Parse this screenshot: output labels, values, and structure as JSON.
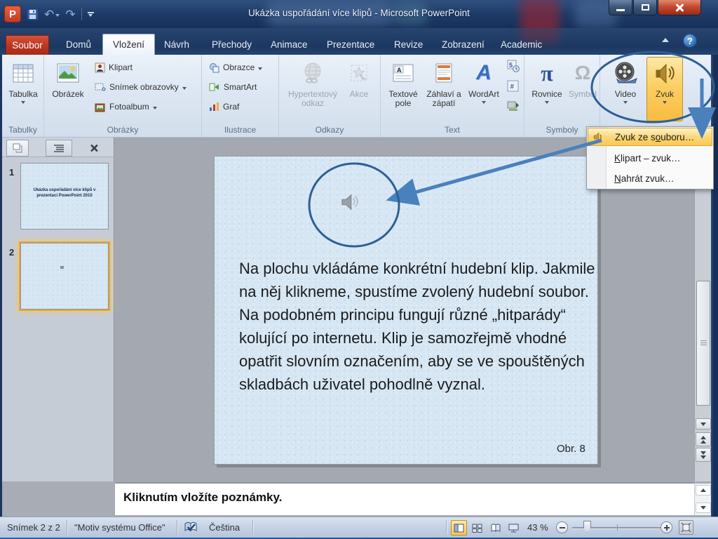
{
  "window": {
    "title": "Ukázka uspořádání více klipů  -  Microsoft PowerPoint"
  },
  "tabs": {
    "file": "Soubor",
    "items": [
      "Domů",
      "Vložení",
      "Návrh",
      "Přechody",
      "Animace",
      "Prezentace",
      "Revize",
      "Zobrazení",
      "Academic"
    ],
    "active": "Vložení"
  },
  "ribbon": {
    "tabulka": "Tabulka",
    "obrazek": "Obrázek",
    "klipart": "Klipart",
    "snimek": "Snímek obrazovky",
    "fotoalbum": "Fotoalbum",
    "obrazce": "Obrazce",
    "smartart": "SmartArt",
    "graf": "Graf",
    "hypertext": "Hypertextový odkaz",
    "akce": "Akce",
    "textove_pole": "Textové pole",
    "zahlavi": "Záhlaví a zápatí",
    "wordart": "WordArt",
    "rovnice": "Rovnice",
    "symbol": "Symbol",
    "video": "Video",
    "zvuk": "Zvuk",
    "glabels": {
      "tabulky": "Tabulky",
      "obrazky": "Obrázky",
      "ilustrace": "Ilustrace",
      "odkazy": "Odkazy",
      "text": "Text",
      "symboly": "Symboly"
    }
  },
  "icons": {
    "logo_letter": "P",
    "help_glyph": "?",
    "undo_glyph": "↶",
    "redo_glyph": "↷",
    "wordart_glyph": "A",
    "rovnice_glyph": "π",
    "symbol_glyph": "Ω",
    "slide_number_glyph": "#"
  },
  "zvuk_menu": {
    "items": [
      {
        "pre": "Zvuk ze s",
        "accel": "o",
        "post": "uboru…"
      },
      {
        "pre": "",
        "accel": "K",
        "post": "lipart – zvuk…"
      },
      {
        "pre": "",
        "accel": "N",
        "post": "ahrát zvuk…"
      }
    ]
  },
  "slides_panel": {
    "slide1_number": "1",
    "slide1_text": "Ukázka uspořádání více klipů v prezentaci PowerPoint 2010",
    "slide2_number": "2"
  },
  "slide": {
    "body": "Na plochu vkládáme konkrétní hudební klip. Jakmile na něj klikneme, spustíme zvolený hudební soubor. Na podobném principu fungují různé „hitparády“ kolující po internetu. Klip je samozřejmě vhodné opatřit slovním označením, aby se ve spouštěných skladbách uživatel pohodlně vyznal.",
    "caption": "Obr. 8"
  },
  "notes": {
    "placeholder": "Kliknutím vložíte poznámky."
  },
  "status": {
    "slide_indicator": "Snímek 2 z 2",
    "theme": "\"Motiv systému Office\"",
    "language": "Čeština",
    "zoom_level": "43 %"
  },
  "colors": {
    "accent_orange": "#fbc94f",
    "annotation_blue": "#2e5f94",
    "arrow_blue": "#4a80bc",
    "soubor_red": "#bc3722",
    "titlebar_blue": "#1d3a66"
  }
}
